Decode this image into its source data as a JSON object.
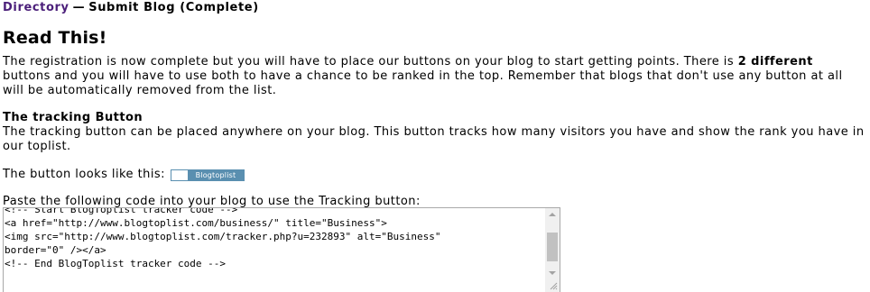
{
  "breadcrumb": {
    "link_label": "Directory",
    "separator": "—",
    "current": "Submit Blog (Complete)"
  },
  "page_title": "Read This!",
  "intro": {
    "part1": "The registration is now complete but you will have to place our buttons on your blog to start getting points. There is ",
    "bold": "2 different",
    "part2": " buttons and you will have to use both to have a chance to be ranked in the top. Remember that blogs that don't use any button at all will be automatically removed from the list."
  },
  "tracking_section": {
    "title": "The tracking Button",
    "description": "The tracking button can be placed anywhere on your blog. This button tracks how many visitors you have and show the rank you have in our toplist.",
    "button_label": "The button looks like this:",
    "badge_text": "Blogtoplist",
    "paste_label": "Paste the following code into your blog to use the Tracking button:",
    "code": "<!-- Start BlogToplist tracker code -->\n<a href=\"http://www.blogtoplist.com/business/\" title=\"Business\">\n<img src=\"http://www.blogtoplist.com/tracker.php?u=232893\" alt=\"Business\"\nborder=\"0\" /></a>\n<!-- End BlogToplist tracker code -->"
  },
  "colors": {
    "link": "#4b1f7a",
    "badge": "#5a8fb0"
  },
  "icons": {
    "scroll_up": "scroll-up-arrow-icon",
    "scroll_down": "scroll-down-arrow-icon",
    "resize": "resize-grip-icon"
  }
}
